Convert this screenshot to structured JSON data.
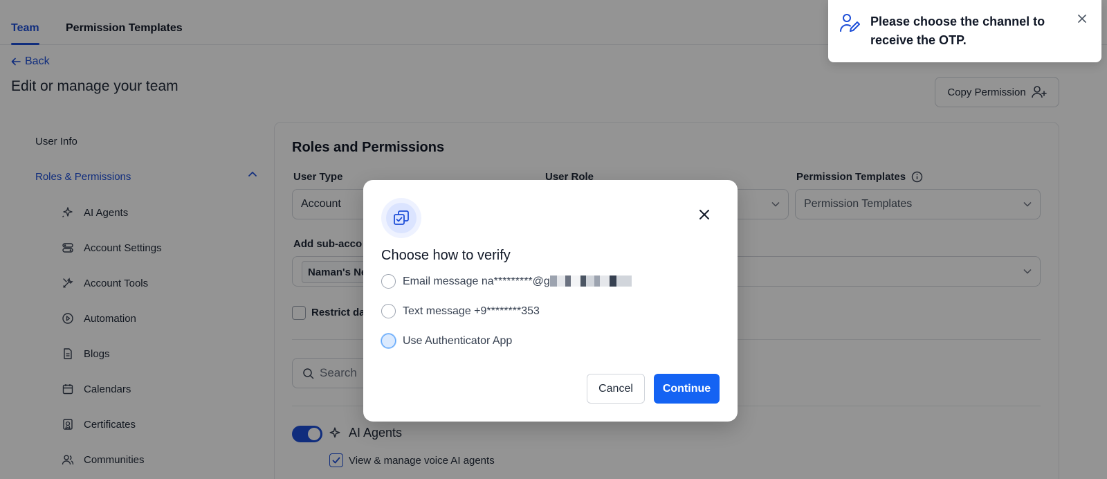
{
  "tabs": [
    {
      "label": "Team",
      "active": true
    },
    {
      "label": "Permission Templates",
      "active": false
    }
  ],
  "back_label": "Back",
  "page_title": "Edit or manage your team",
  "copy_permission_label": "Copy Permission",
  "sidebar": {
    "items": [
      {
        "label": "User Info",
        "icon": "none"
      },
      {
        "label": "Roles & Permissions",
        "icon": "chevron-up-icon",
        "active": true
      },
      {
        "label": "AI Agents",
        "icon": "sparkle-icon"
      },
      {
        "label": "Account Settings",
        "icon": "toggles-icon"
      },
      {
        "label": "Account Tools",
        "icon": "tools-icon"
      },
      {
        "label": "Automation",
        "icon": "play-circle-icon"
      },
      {
        "label": "Blogs",
        "icon": "document-icon"
      },
      {
        "label": "Calendars",
        "icon": "calendar-icon"
      },
      {
        "label": "Certificates",
        "icon": "certificate-icon"
      },
      {
        "label": "Communities",
        "icon": "users-icon"
      }
    ]
  },
  "main": {
    "title": "Roles and Permissions",
    "user_type_label": "User Type",
    "user_type_value": "Account",
    "user_role_label": "User Role",
    "permission_templates_label": "Permission Templates",
    "permission_templates_placeholder": "Permission Templates",
    "sub_account_label": "Add sub-acco",
    "sub_account_chip": "Naman's Ne",
    "restrict_label": "Restrict da",
    "search_placeholder": "Search",
    "ai_agents_label": "AI Agents",
    "ai_agents_sub": "View & manage voice AI agents"
  },
  "toast": {
    "message": "Please choose the channel to receive the OTP."
  },
  "modal": {
    "title": "Choose how to verify",
    "options": [
      {
        "label": "Email message na*********@g"
      },
      {
        "label": "Text message +9********353"
      },
      {
        "label": "Use Authenticator App"
      }
    ],
    "cancel_label": "Cancel",
    "continue_label": "Continue"
  },
  "colors": {
    "accent": "#1d4ed8",
    "continue_button": "#1463f3"
  }
}
